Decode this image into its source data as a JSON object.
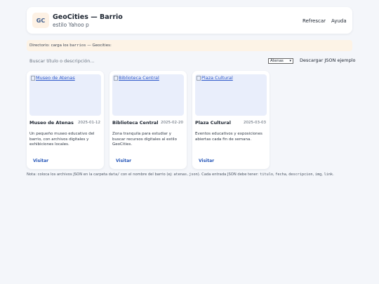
{
  "header": {
    "logo_text": "GC",
    "title": "GeoCities — Barrio",
    "subtitle": "estilo Yahoo p",
    "refresh_label": "Refrescar",
    "help_label": "Ayuda"
  },
  "directory": {
    "prefix": "Directorio: carga los",
    "code": "barrios",
    "suffix": "— Geocities:"
  },
  "search": {
    "placeholder": "Buscar título o descripción..."
  },
  "filter": {
    "selected": "Atenas"
  },
  "download_label": "Descargar JSON ejemplo",
  "cards": [
    {
      "image_alt": "Museo de Atenas",
      "name": "Museo de Atenas",
      "date": "2025-01-12",
      "description": "Un pequeño museo educativo del barrio, con archivos digitales y exhibiciones locales.",
      "visit_label": "Visitar"
    },
    {
      "image_alt": "Biblioteca Central",
      "name": "Biblioteca Central",
      "date": "2025-02-20",
      "description": "Zona tranquila para estudiar y buscar recursos digitales al estilo GeoCities.",
      "visit_label": "Visitar"
    },
    {
      "image_alt": "Plaza Cultural",
      "name": "Plaza Cultural",
      "date": "2025-03-03",
      "description": "Eventos educativos y exposiciones abiertas cada fin de semana.",
      "visit_label": "Visitar"
    }
  ],
  "note": {
    "t1": "Nota: coloca los archivos JSON en la carpeta",
    "c1": "data/",
    "t2": "con el nombre del barrio (ej:",
    "c2": "atenas.json",
    "t3": "). Cada entrada JSON debe tener:",
    "c3": "titulo",
    "s1": ",",
    "c4": "fecha",
    "s2": ",",
    "c5": "descripcion",
    "s3": ",",
    "c6": "img",
    "s4": ",",
    "c7": "link",
    "t4": "."
  },
  "colors": {
    "background": "#f4f6fa",
    "accent_link": "#2455b8",
    "directory_bar": "#fdf3e6",
    "image_placeholder": "#e9eefb"
  }
}
